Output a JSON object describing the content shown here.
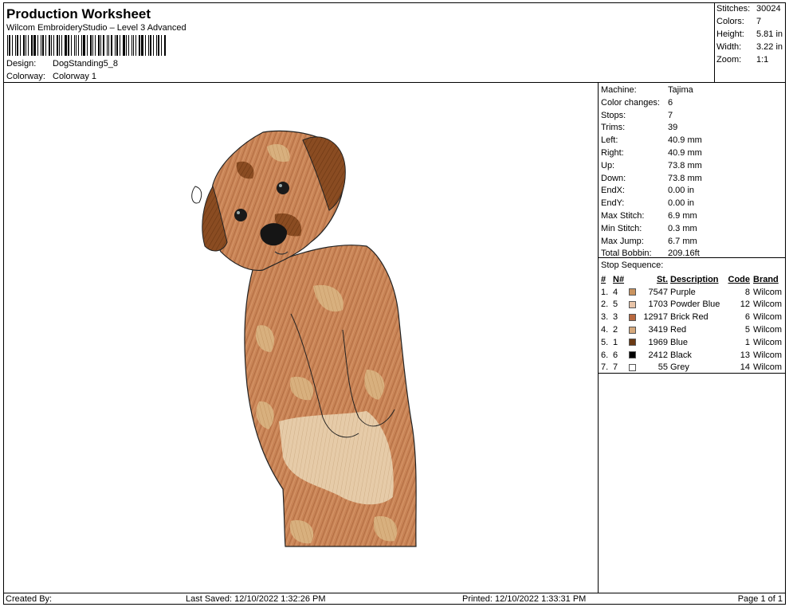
{
  "header": {
    "title": "Production Worksheet",
    "subtitle": "Wilcom EmbroideryStudio – Level 3 Advanced",
    "design_label": "Design:",
    "design_value": "DogStanding5_8",
    "colorway_label": "Colorway:",
    "colorway_value": "Colorway 1"
  },
  "stats": [
    {
      "label": "Stitches:",
      "value": "30024"
    },
    {
      "label": "Colors:",
      "value": "7"
    },
    {
      "label": "Height:",
      "value": "5.81 in"
    },
    {
      "label": "Width:",
      "value": "3.22 in"
    },
    {
      "label": "Zoom:",
      "value": "1:1"
    }
  ],
  "machine": [
    {
      "label": "Machine:",
      "value": "Tajima"
    },
    {
      "label": "Color changes:",
      "value": "6"
    },
    {
      "label": "Stops:",
      "value": "7"
    },
    {
      "label": "Trims:",
      "value": "39"
    },
    {
      "label": "Left:",
      "value": "40.9 mm"
    },
    {
      "label": "Right:",
      "value": "40.9 mm"
    },
    {
      "label": "Up:",
      "value": "73.8 mm"
    },
    {
      "label": "Down:",
      "value": "73.8 mm"
    },
    {
      "label": "EndX:",
      "value": "0.00 in"
    },
    {
      "label": "EndY:",
      "value": "0.00 in"
    },
    {
      "label": "Max Stitch:",
      "value": "6.9 mm"
    },
    {
      "label": "Min Stitch:",
      "value": "0.3 mm"
    },
    {
      "label": "Max Jump:",
      "value": "6.7 mm"
    },
    {
      "label": "Total Bobbin:",
      "value": "209.16ft"
    }
  ],
  "stop_sequence": {
    "title": "Stop Sequence:",
    "headers": {
      "num": "#",
      "n": "N#",
      "st": "St.",
      "desc": "Description",
      "code": "Code",
      "brand": "Brand"
    },
    "rows": [
      {
        "num": "1.",
        "n": "4",
        "color": "#c9935f",
        "st": "7547",
        "desc": "Purple",
        "code": "8",
        "brand": "Wilcom"
      },
      {
        "num": "2.",
        "n": "5",
        "color": "#e8c4a8",
        "st": "1703",
        "desc": "Powder Blue",
        "code": "12",
        "brand": "Wilcom"
      },
      {
        "num": "3.",
        "n": "3",
        "color": "#b8683e",
        "st": "12917",
        "desc": "Brick Red",
        "code": "6",
        "brand": "Wilcom"
      },
      {
        "num": "4.",
        "n": "2",
        "color": "#d6a97c",
        "st": "3419",
        "desc": "Red",
        "code": "5",
        "brand": "Wilcom"
      },
      {
        "num": "5.",
        "n": "1",
        "color": "#6b3a14",
        "st": "1969",
        "desc": "Blue",
        "code": "1",
        "brand": "Wilcom"
      },
      {
        "num": "6.",
        "n": "6",
        "color": "#000000",
        "st": "2412",
        "desc": "Black",
        "code": "13",
        "brand": "Wilcom"
      },
      {
        "num": "7.",
        "n": "7",
        "color": "#ffffff",
        "st": "55",
        "desc": "Grey",
        "code": "14",
        "brand": "Wilcom"
      }
    ]
  },
  "footer": {
    "created": "Created By:",
    "saved": "Last Saved: 12/10/2022 1:32:26 PM",
    "printed": "Printed: 12/10/2022 1:33:31 PM",
    "page": "Page 1 of 1"
  },
  "design_image": {
    "subject": "embroidered standing dog"
  }
}
